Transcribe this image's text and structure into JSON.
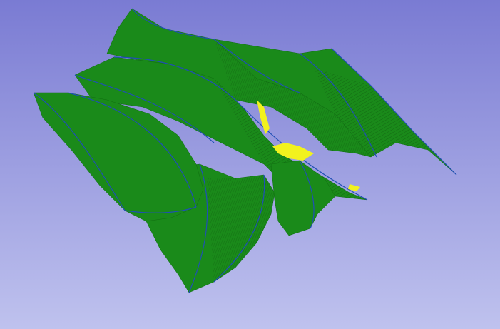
{
  "viewer": {
    "background_top": "#7a7bd3",
    "background_bottom": "#bfc2ee",
    "mesh_color": "#1a8a1a",
    "mesh_color_dark": "#0f6d10",
    "mesh_color_light": "#2aa82a",
    "edge_color": "#1f4fb5",
    "highlight_color": "#f2f21e"
  }
}
